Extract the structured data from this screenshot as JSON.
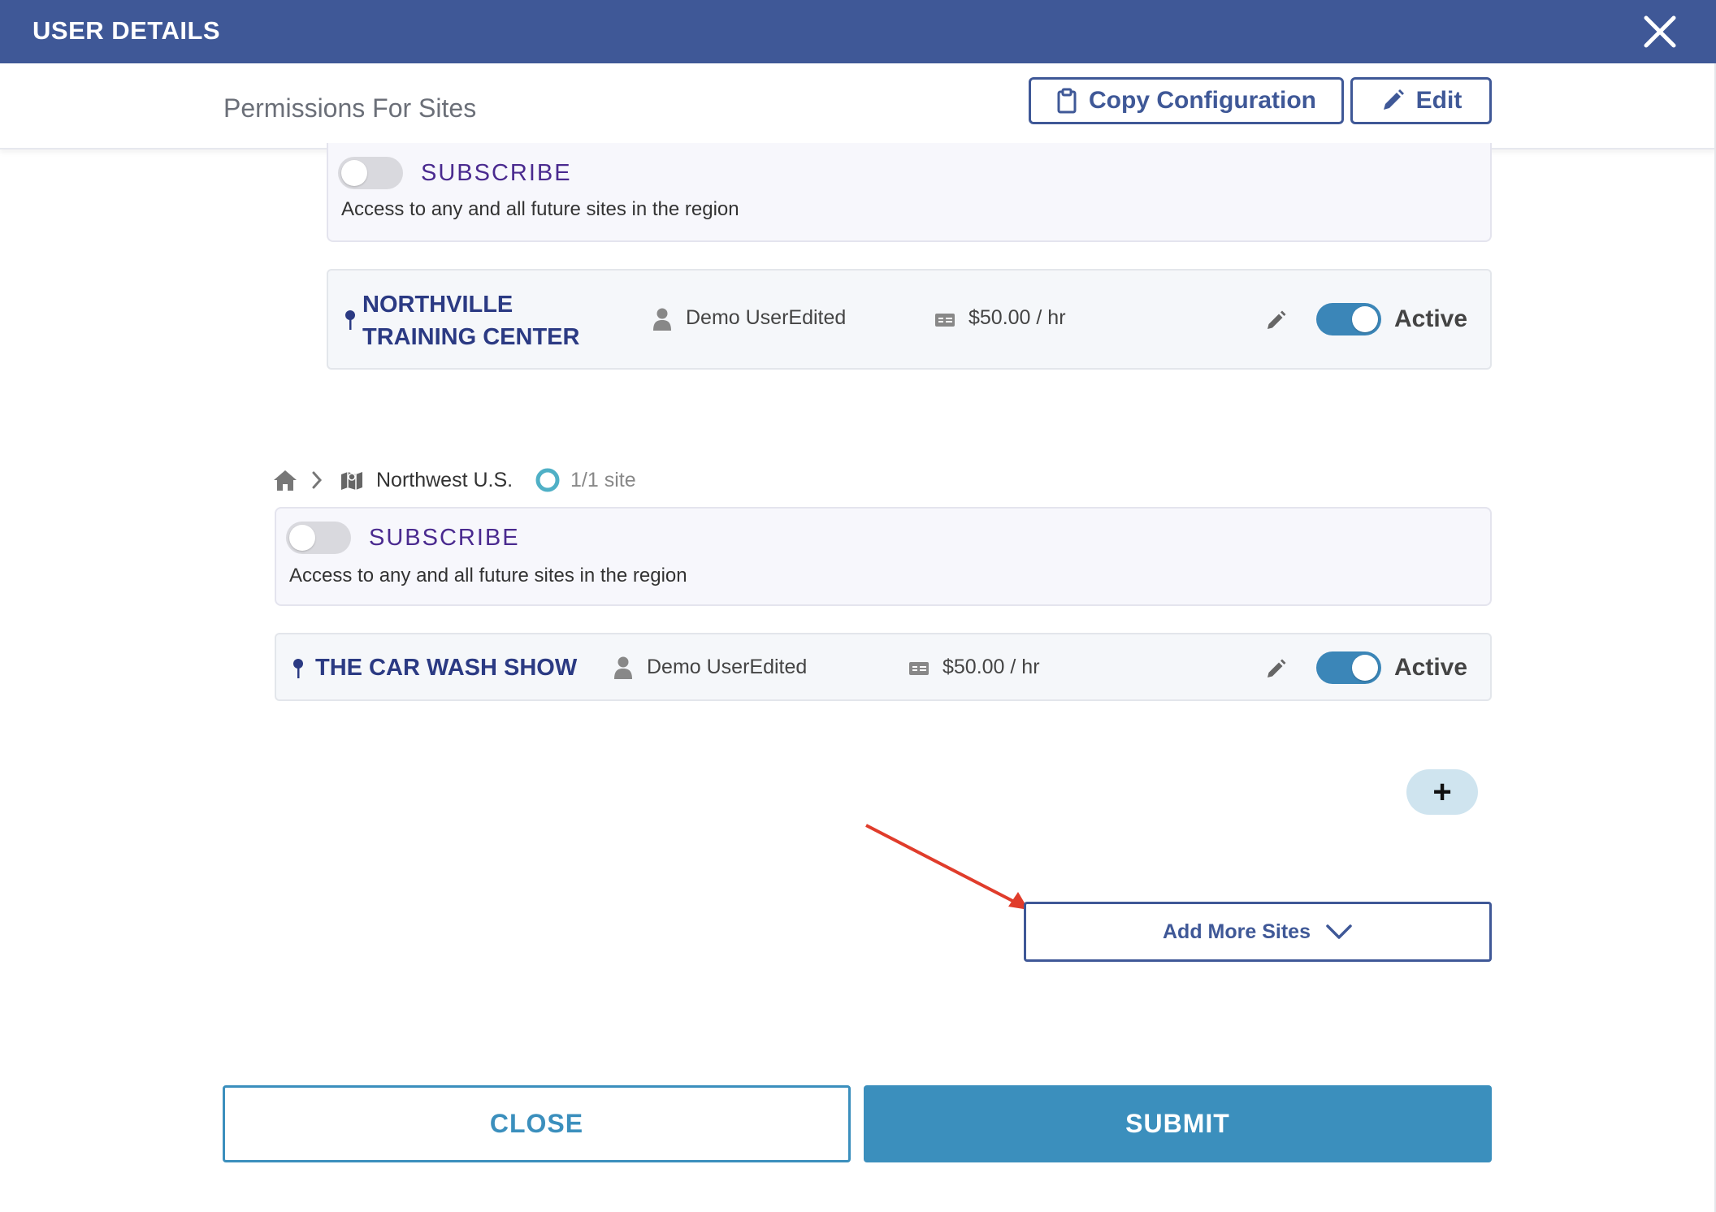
{
  "header": {
    "title": "USER DETAILS",
    "close_icon": "close-icon"
  },
  "subheader": {
    "title": "Permissions For Sites",
    "copy_label": "Copy Configuration",
    "edit_label": "Edit"
  },
  "region_1": {
    "subscribe": {
      "label": "SUBSCRIBE",
      "enabled": false,
      "description": "Access to any and all future sites in the region"
    },
    "sites": [
      {
        "name_line1": "NORTHVILLE",
        "name_line2": "TRAINING CENTER",
        "user": "Demo UserEdited",
        "rate": "$50.00 / hr",
        "status": "Active",
        "active": true
      }
    ]
  },
  "region_2": {
    "breadcrumb": {
      "region": "Northwest U.S.",
      "count": "1/1 site"
    },
    "subscribe": {
      "label": "SUBSCRIBE",
      "enabled": false,
      "description": "Access to any and all future sites in the region"
    },
    "sites": [
      {
        "name": "THE CAR WASH SHOW",
        "user": "Demo UserEdited",
        "rate": "$50.00 / hr",
        "status": "Active",
        "active": true
      }
    ]
  },
  "actions": {
    "add_plus": "+",
    "add_more_label": "Add More Sites",
    "close_label": "CLOSE",
    "submit_label": "SUBMIT"
  },
  "colors": {
    "header": "#3f5897",
    "primary": "#3b8fbd",
    "site_name": "#2b3a83",
    "subscribe": "#4a2a8f",
    "annotation_arrow": "#e03c2b"
  }
}
